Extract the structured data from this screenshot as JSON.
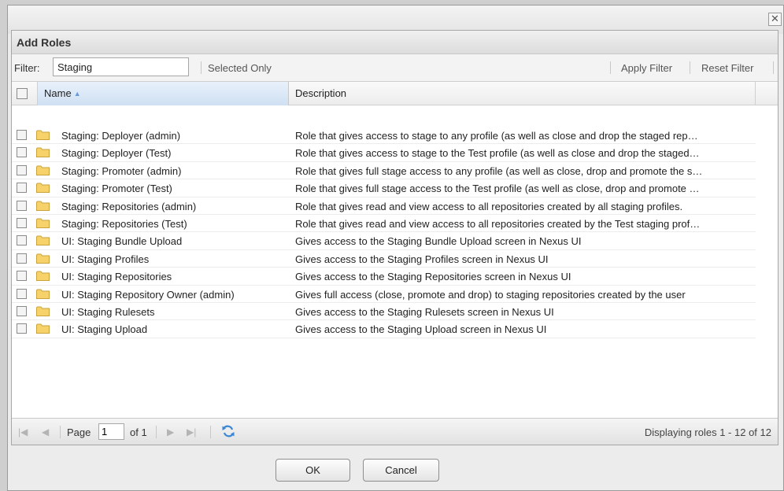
{
  "dialog": {
    "close_glyph": "✕",
    "panel_title": "Add Roles"
  },
  "toolbar": {
    "filter_label": "Filter:",
    "filter_value": "Staging",
    "selected_only": "Selected Only",
    "apply_filter": "Apply Filter",
    "reset_filter": "Reset Filter"
  },
  "grid": {
    "columns": {
      "name": "Name",
      "description": "Description"
    },
    "rows": [
      {
        "name": "Staging: Deployer (admin)",
        "description": "Role that gives access to stage to any profile (as well as close and drop the staged rep…"
      },
      {
        "name": "Staging: Deployer (Test)",
        "description": "Role that gives access to stage to the Test profile (as well as close and drop the staged…"
      },
      {
        "name": "Staging: Promoter (admin)",
        "description": "Role that gives full stage access to any profile (as well as close, drop and promote the s…"
      },
      {
        "name": "Staging: Promoter (Test)",
        "description": "Role that gives full stage access to the Test profile (as well as close, drop and promote …"
      },
      {
        "name": "Staging: Repositories (admin)",
        "description": "Role that gives read and view access to all repositories created by all staging profiles."
      },
      {
        "name": "Staging: Repositories (Test)",
        "description": "Role that gives read and view access to all repositories created by the Test staging prof…"
      },
      {
        "name": "UI: Staging Bundle Upload",
        "description": "Gives access to the Staging Bundle Upload screen in Nexus UI"
      },
      {
        "name": "UI: Staging Profiles",
        "description": "Gives access to the Staging Profiles screen in Nexus UI"
      },
      {
        "name": "UI: Staging Repositories",
        "description": "Gives access to the Staging Repositories screen in Nexus UI"
      },
      {
        "name": "UI: Staging Repository Owner (admin)",
        "description": "Gives full access (close, promote and drop) to staging repositories created by the user"
      },
      {
        "name": "UI: Staging Rulesets",
        "description": "Gives access to the Staging Rulesets screen in Nexus UI"
      },
      {
        "name": "UI: Staging Upload",
        "description": "Gives access to the Staging Upload screen in Nexus UI"
      }
    ]
  },
  "pager": {
    "page_label": "Page",
    "page_value": "1",
    "of_label": "of 1",
    "display_text": "Displaying roles 1 - 12 of 12",
    "icons": [
      "first-page-icon",
      "prev-page-icon",
      "next-page-icon",
      "last-page-icon",
      "refresh-icon"
    ]
  },
  "buttons": {
    "ok": "OK",
    "cancel": "Cancel"
  },
  "colors": {
    "header_sort": "#cfe0f3",
    "folder": "#f7d26b",
    "folder_edge": "#c9a23a"
  }
}
